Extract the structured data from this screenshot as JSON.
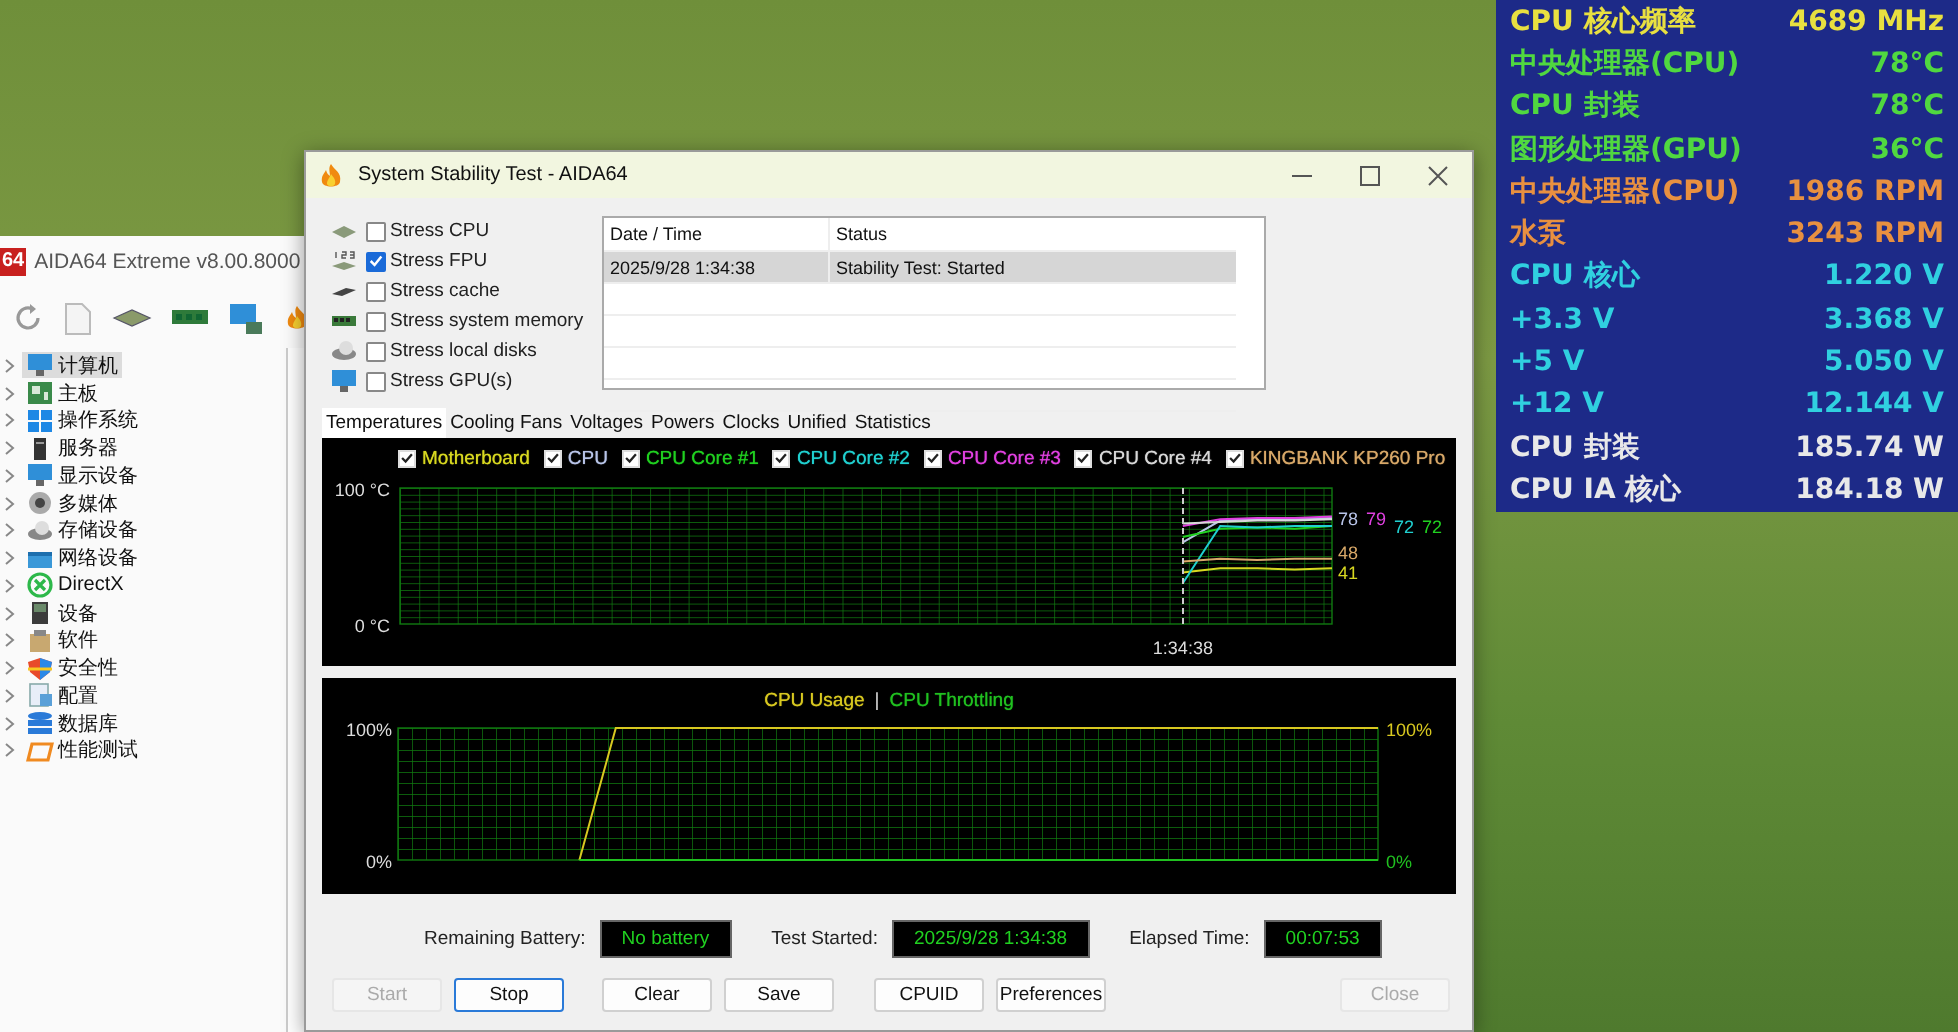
{
  "main_window": {
    "logo": "64",
    "title": "AIDA64 Extreme v8.00.8000",
    "tree": [
      {
        "label": "计算机",
        "selected": true
      },
      {
        "label": "主板",
        "selected": false
      },
      {
        "label": "操作系统",
        "selected": false
      },
      {
        "label": "服务器",
        "selected": false
      },
      {
        "label": "显示设备",
        "selected": false
      },
      {
        "label": "多媒体",
        "selected": false
      },
      {
        "label": "存储设备",
        "selected": false
      },
      {
        "label": "网络设备",
        "selected": false
      },
      {
        "label": "DirectX",
        "selected": false
      },
      {
        "label": "设备",
        "selected": false
      },
      {
        "label": "软件",
        "selected": false
      },
      {
        "label": "安全性",
        "selected": false
      },
      {
        "label": "配置",
        "selected": false
      },
      {
        "label": "数据库",
        "selected": false
      },
      {
        "label": "性能测试",
        "selected": false
      }
    ]
  },
  "dialog": {
    "title": "System Stability Test - AIDA64",
    "stress_options": [
      {
        "label": "Stress CPU",
        "checked": false
      },
      {
        "label": "Stress FPU",
        "checked": true
      },
      {
        "label": "Stress cache",
        "checked": false
      },
      {
        "label": "Stress system memory",
        "checked": false
      },
      {
        "label": "Stress local disks",
        "checked": false
      },
      {
        "label": "Stress GPU(s)",
        "checked": false
      }
    ],
    "log": {
      "columns": [
        "Date / Time",
        "Status"
      ],
      "rows": [
        {
          "cells": [
            "2025/9/28 1:34:38",
            "Stability Test: Started"
          ],
          "selected": true
        }
      ]
    },
    "tabs": [
      {
        "label": "Temperatures",
        "selected": true
      },
      {
        "label": "Cooling Fans",
        "selected": false
      },
      {
        "label": "Voltages",
        "selected": false
      },
      {
        "label": "Powers",
        "selected": false
      },
      {
        "label": "Clocks",
        "selected": false
      },
      {
        "label": "Unified",
        "selected": false
      },
      {
        "label": "Statistics",
        "selected": false
      }
    ],
    "temperature_chart": {
      "axis_labels": [
        "100 °C",
        "0 °C"
      ],
      "series": [
        {
          "name": "Motherboard",
          "color": "#d8d820",
          "checked": true
        },
        {
          "name": "CPU",
          "color": "#b8c4e8",
          "checked": true
        },
        {
          "name": "CPU Core #1",
          "color": "#20d020",
          "checked": true
        },
        {
          "name": "CPU Core #2",
          "color": "#20d0d0",
          "checked": true
        },
        {
          "name": "CPU Core #3",
          "color": "#e040e0",
          "checked": true
        },
        {
          "name": "CPU Core #4",
          "color": "#d8d8d8",
          "checked": true
        },
        {
          "name": "KINGBANK KP260 Pro",
          "color": "#d8a868",
          "checked": true
        }
      ],
      "time_marker": "1:34:38",
      "readings": [
        {
          "text": "78",
          "color": "#b8c4e8"
        },
        {
          "text": "79",
          "color": "#e040e0"
        },
        {
          "text": "72",
          "color": "#20d0d0"
        },
        {
          "text": "72",
          "color": "#20d020"
        },
        {
          "text": "48",
          "color": "#d8a868"
        },
        {
          "text": "41",
          "color": "#d8d820"
        }
      ]
    },
    "usage_chart": {
      "separator": "|",
      "axis_labels": [
        "100%",
        "0%"
      ],
      "readings": [
        "100%",
        "0%"
      ],
      "series": [
        {
          "name": "CPU Usage",
          "color": "#d8c820"
        },
        {
          "name": "CPU Throttling",
          "color": "#20c020"
        }
      ]
    },
    "status": [
      {
        "label": "Remaining Battery:",
        "value": "No battery"
      },
      {
        "label": "Test Started:",
        "value": "2025/9/28 1:34:38"
      },
      {
        "label": "Elapsed Time:",
        "value": "00:07:53"
      }
    ],
    "buttons": [
      {
        "label": "Start",
        "disabled": true,
        "focused": false
      },
      {
        "label": "Stop",
        "disabled": false,
        "focused": true
      },
      {
        "label": "Clear",
        "disabled": false,
        "focused": false
      },
      {
        "label": "Save",
        "disabled": false,
        "focused": false
      },
      {
        "label": "CPUID",
        "disabled": false,
        "focused": false
      },
      {
        "label": "Preferences",
        "disabled": false,
        "focused": false
      },
      {
        "label": "Close",
        "disabled": true,
        "focused": false
      }
    ]
  },
  "sensor_overlay": {
    "rows": [
      {
        "label": "CPU 核心频率",
        "value": "4689 MHz",
        "color": "#e8e040"
      },
      {
        "label": "中央处理器(CPU)",
        "value": "78°C",
        "color": "#50d840"
      },
      {
        "label": "CPU 封装",
        "value": "78°C",
        "color": "#50d840"
      },
      {
        "label": "图形处理器(GPU)",
        "value": "36°C",
        "color": "#50d840"
      },
      {
        "label": "中央处理器(CPU)",
        "value": "1986 RPM",
        "color": "#e89040"
      },
      {
        "label": "水泵",
        "value": "3243 RPM",
        "color": "#e89040"
      },
      {
        "label": "CPU 核心",
        "value": "1.220 V",
        "color": "#30d0e0"
      },
      {
        "label": "+3.3 V",
        "value": "3.368 V",
        "color": "#30d0e0"
      },
      {
        "label": "+5 V",
        "value": "5.050 V",
        "color": "#30d0e0"
      },
      {
        "label": "+12 V",
        "value": "12.144 V",
        "color": "#30d0e0"
      },
      {
        "label": "CPU 封装",
        "value": "185.74 W",
        "color": "#e8e8e8"
      },
      {
        "label": "CPU IA 核心",
        "value": "184.18 W",
        "color": "#e8e8e8"
      }
    ]
  }
}
